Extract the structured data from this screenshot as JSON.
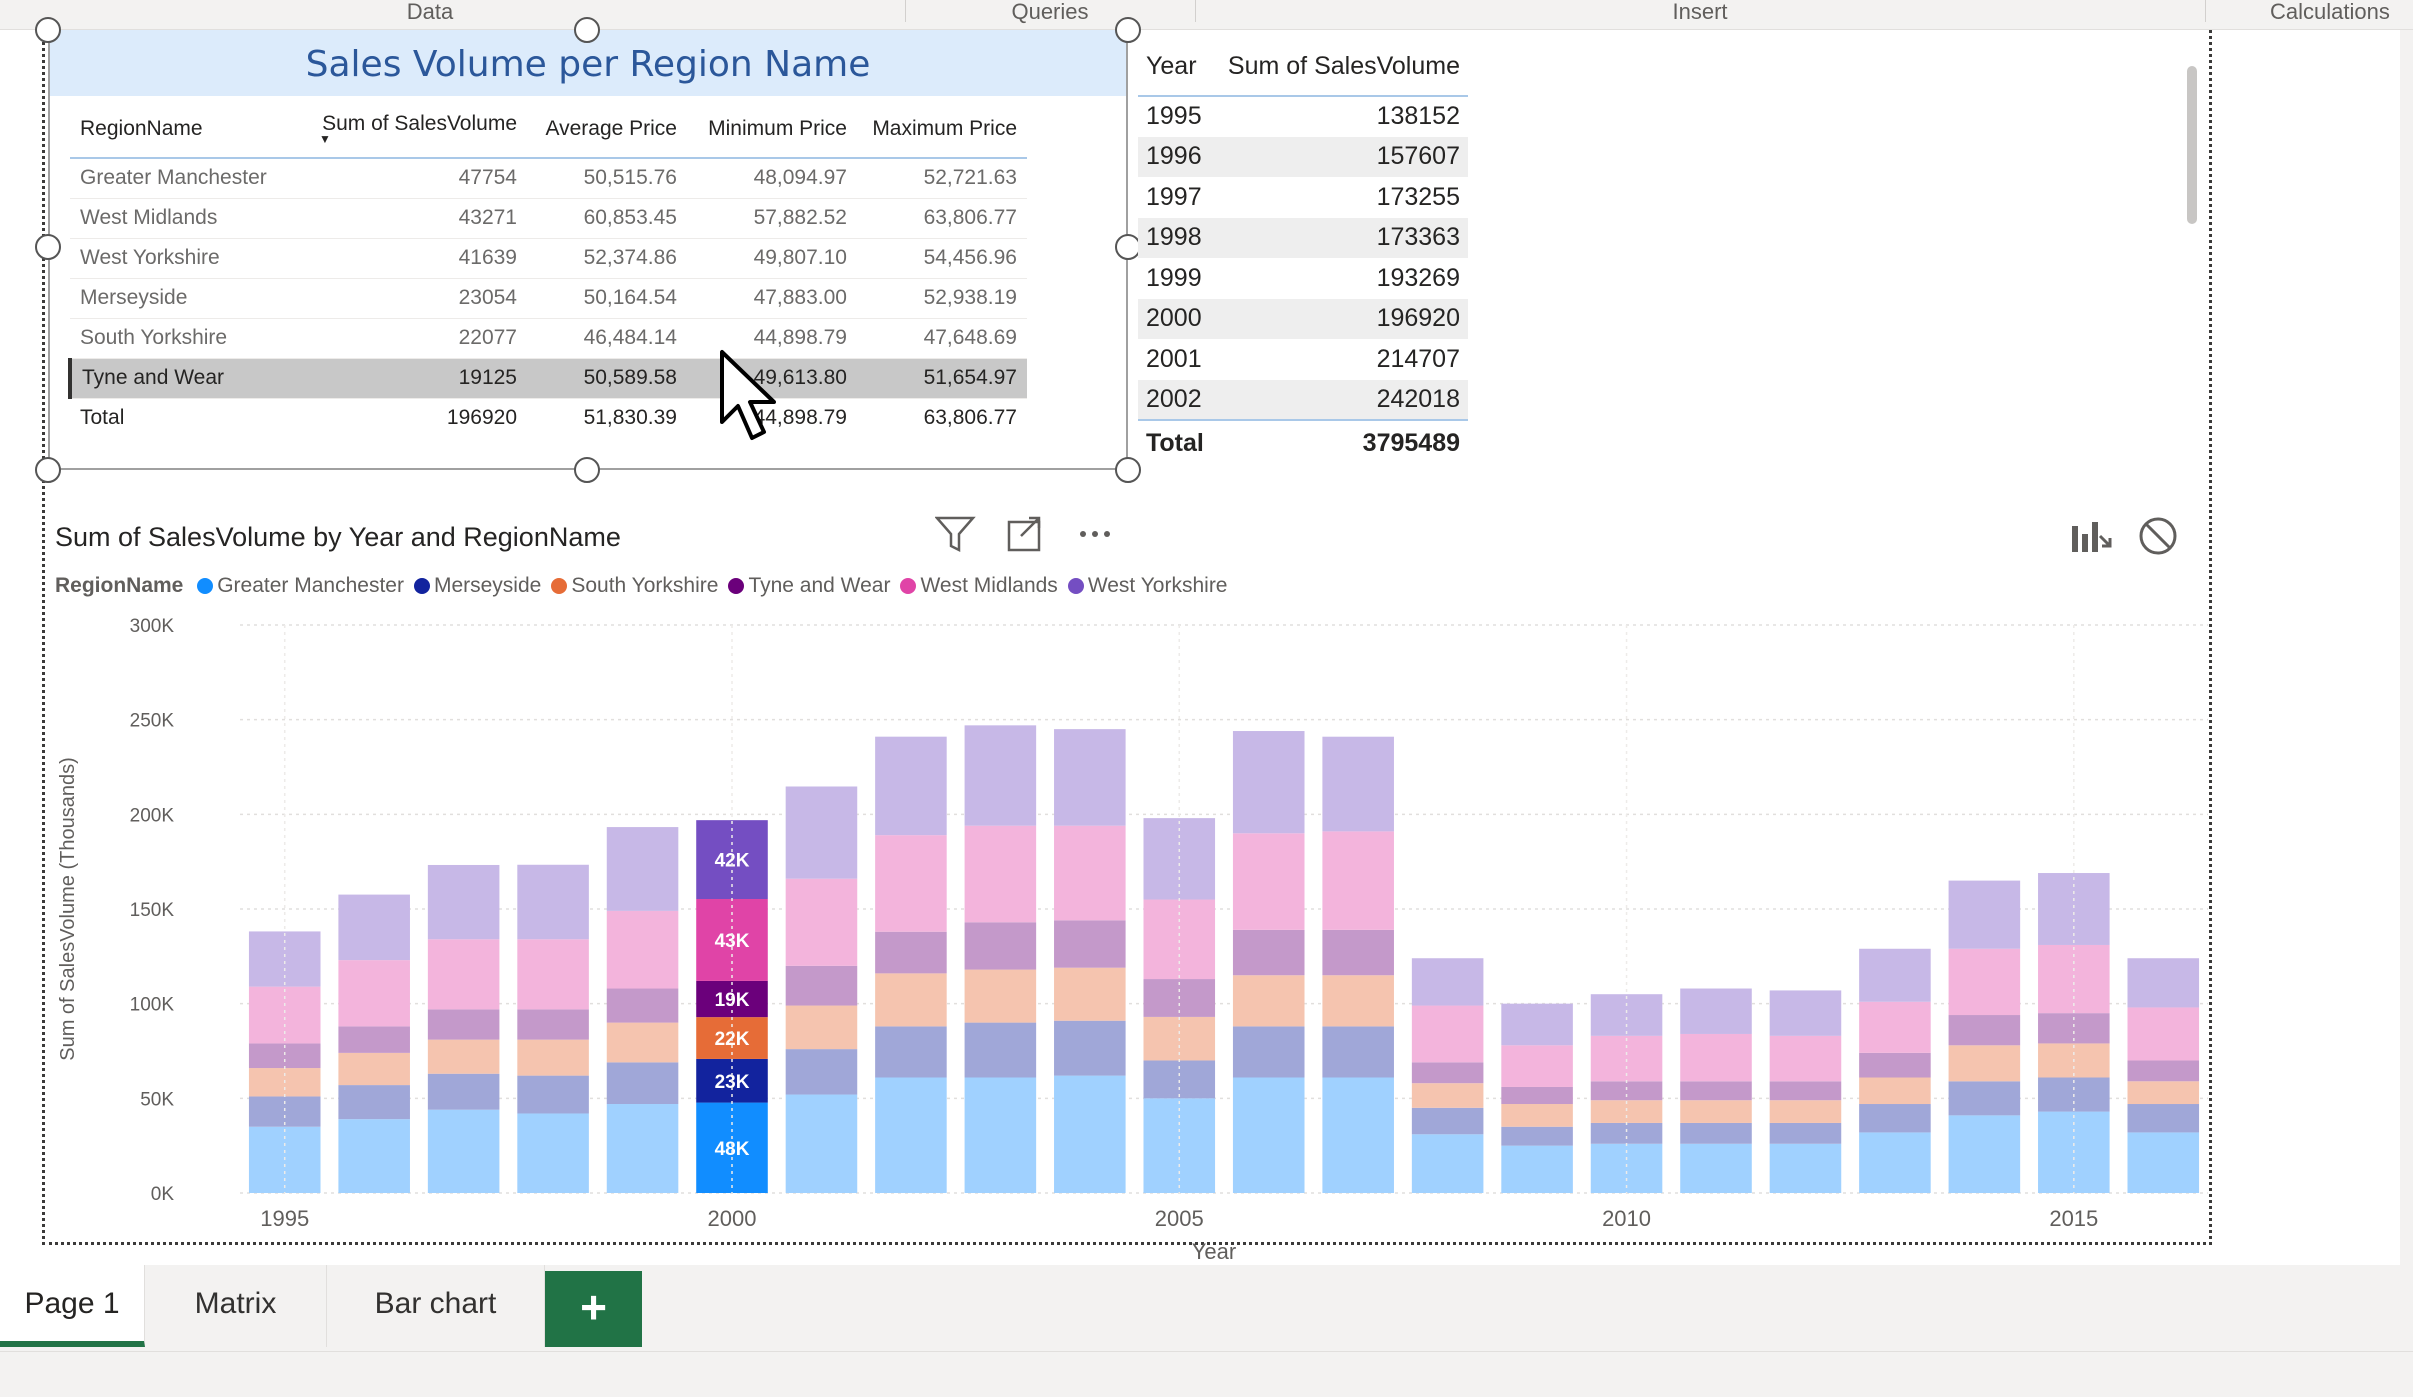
{
  "ribbon": {
    "groups": [
      "Data",
      "Queries",
      "Insert",
      "Calculations"
    ]
  },
  "matrix": {
    "title": "Sales Volume per Region Name",
    "columns": [
      "RegionName",
      "Sum of SalesVolume",
      "Average Price",
      "Minimum Price",
      "Maximum Price"
    ],
    "rows": [
      [
        "Greater Manchester",
        "47754",
        "50,515.76",
        "48,094.97",
        "52,721.63"
      ],
      [
        "West Midlands",
        "43271",
        "60,853.45",
        "57,882.52",
        "63,806.77"
      ],
      [
        "West Yorkshire",
        "41639",
        "52,374.86",
        "49,807.10",
        "54,456.96"
      ],
      [
        "Merseyside",
        "23054",
        "50,164.54",
        "47,883.00",
        "52,938.19"
      ],
      [
        "South Yorkshire",
        "22077",
        "46,484.14",
        "44,898.79",
        "47,648.69"
      ],
      [
        "Tyne and Wear",
        "19125",
        "50,589.58",
        "49,613.80",
        "51,654.97"
      ]
    ],
    "total": [
      "Total",
      "196920",
      "51,830.39",
      "44,898.79",
      "63,806.77"
    ]
  },
  "year_table": {
    "columns": [
      "Year",
      "Sum of SalesVolume"
    ],
    "rows": [
      [
        "1995",
        "138152"
      ],
      [
        "1996",
        "157607"
      ],
      [
        "1997",
        "173255"
      ],
      [
        "1998",
        "173363"
      ],
      [
        "1999",
        "193269"
      ],
      [
        "2000",
        "196920"
      ],
      [
        "2001",
        "214707"
      ],
      [
        "2002",
        "242018"
      ]
    ],
    "total": [
      "Total",
      "3795489"
    ]
  },
  "chart": {
    "title": "Sum of SalesVolume by Year and RegionName",
    "legend_title": "RegionName",
    "icons": [
      "filter-icon",
      "focus-mode-icon",
      "more-options-icon",
      "drill-icon",
      "block-icon"
    ]
  },
  "chart_data": {
    "type": "bar",
    "stacked": true,
    "title": "Sum of SalesVolume by Year and RegionName",
    "xlabel": "Year",
    "ylabel": "Sum of SalesVolume (Thousands)",
    "ylim": [
      0,
      300000
    ],
    "yticks": [
      "0K",
      "50K",
      "100K",
      "150K",
      "200K",
      "250K",
      "300K"
    ],
    "xtick_labels": [
      "1995",
      "2000",
      "2005",
      "2010",
      "2015"
    ],
    "legend_position": "top-left",
    "highlight_year": 2000,
    "categories": [
      1995,
      1996,
      1997,
      1998,
      1999,
      2000,
      2001,
      2002,
      2003,
      2004,
      2005,
      2006,
      2007,
      2008,
      2009,
      2010,
      2011,
      2012,
      2013,
      2014,
      2015,
      2016
    ],
    "series": [
      {
        "name": "Greater Manchester",
        "color": "#118dff",
        "values": [
          35000,
          39000,
          44000,
          42000,
          47000,
          47754,
          52000,
          61000,
          61000,
          62000,
          50000,
          61000,
          61000,
          31000,
          25000,
          26000,
          26000,
          26000,
          32000,
          41000,
          43000,
          32000
        ]
      },
      {
        "name": "Merseyside",
        "color": "#12239e",
        "values": [
          16000,
          18000,
          19000,
          20000,
          22000,
          23054,
          24000,
          27000,
          29000,
          29000,
          20000,
          27000,
          27000,
          14000,
          10000,
          11000,
          11000,
          11000,
          15000,
          18000,
          18000,
          15000
        ]
      },
      {
        "name": "South Yorkshire",
        "color": "#e66c37",
        "values": [
          15000,
          17000,
          18000,
          19000,
          21000,
          22077,
          23000,
          28000,
          28000,
          28000,
          23000,
          27000,
          27000,
          13000,
          12000,
          12000,
          12000,
          12000,
          14000,
          19000,
          18000,
          12000
        ]
      },
      {
        "name": "Tyne and Wear",
        "color": "#6b007b",
        "values": [
          13000,
          14000,
          16000,
          16000,
          18000,
          19125,
          21000,
          22000,
          25000,
          25000,
          20000,
          24000,
          24000,
          11000,
          9000,
          10000,
          10000,
          10000,
          13000,
          16000,
          16000,
          11000
        ]
      },
      {
        "name": "West Midlands",
        "color": "#e044a7",
        "values": [
          30000,
          35000,
          37000,
          37000,
          41000,
          43271,
          46000,
          51000,
          51000,
          50000,
          42000,
          51000,
          52000,
          30000,
          22000,
          24000,
          25000,
          24000,
          27000,
          35000,
          36000,
          28000
        ]
      },
      {
        "name": "West Yorkshire",
        "color": "#744ec2",
        "values": [
          29152,
          34607,
          39255,
          39363,
          44269,
          41639,
          48707,
          52018,
          53000,
          51000,
          43000,
          54000,
          50000,
          25000,
          22000,
          22000,
          24000,
          24000,
          28000,
          36000,
          38000,
          26000
        ]
      }
    ],
    "data_labels_2000": [
      "48K",
      "23K",
      "22K",
      "19K",
      "43K",
      "42K"
    ]
  },
  "tabs": {
    "items": [
      "Page 1",
      "Matrix",
      "Bar chart"
    ],
    "add_label": "+"
  }
}
